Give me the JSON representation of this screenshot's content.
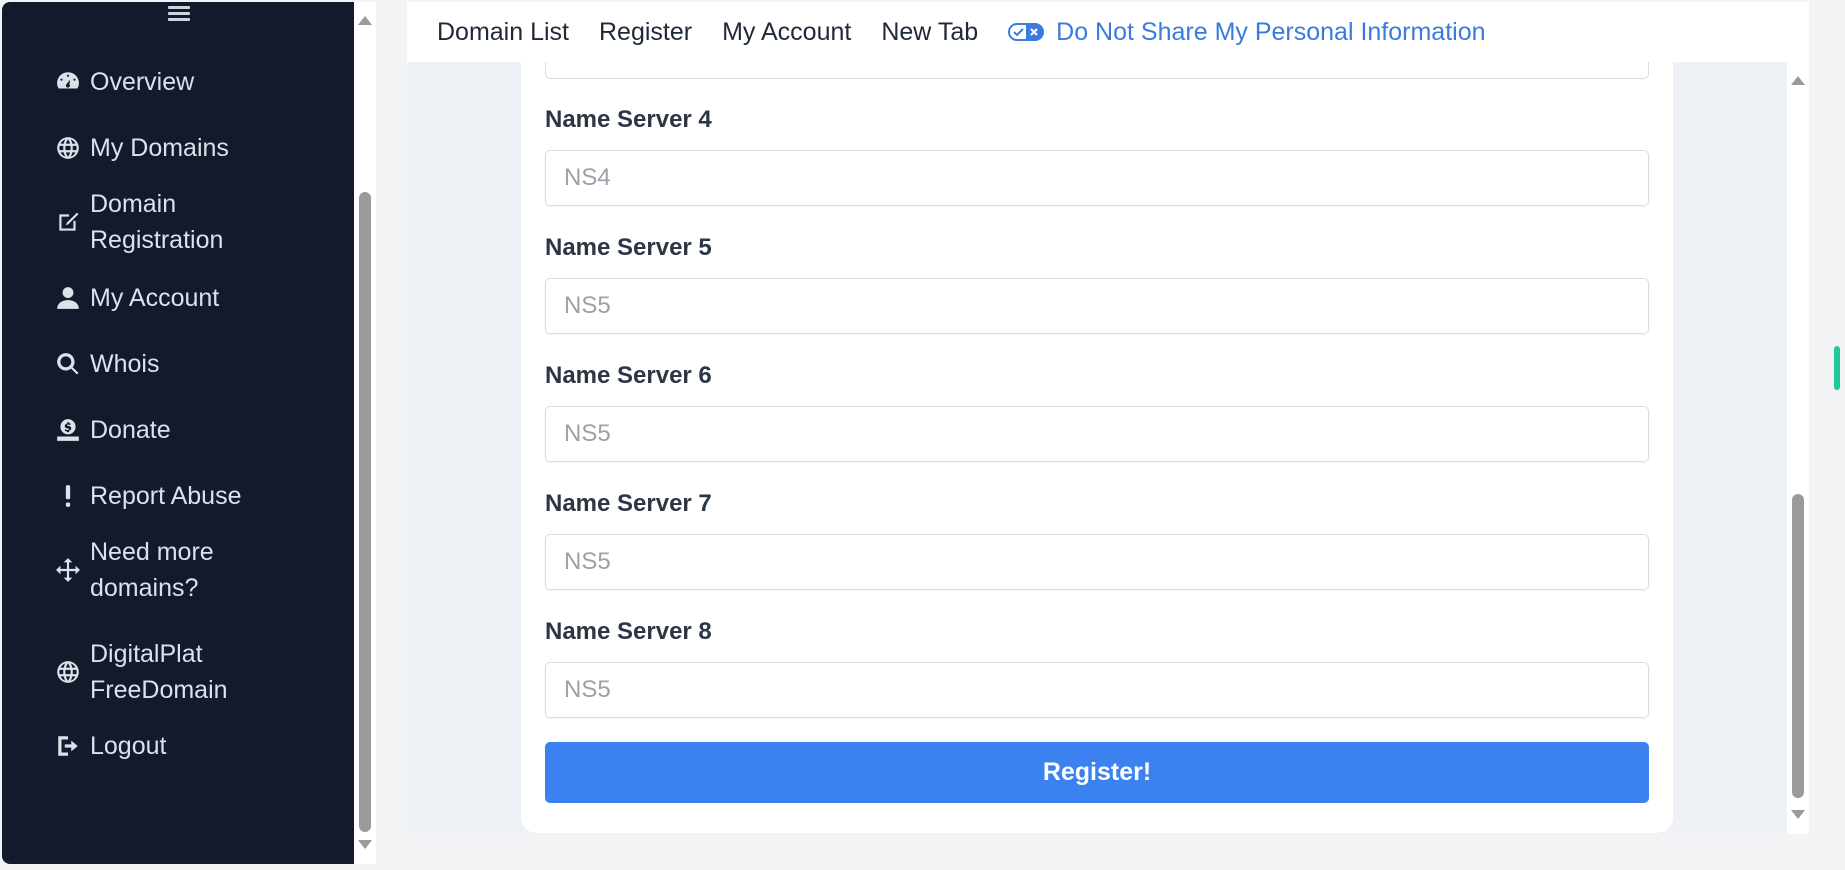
{
  "sidebar": {
    "items": [
      {
        "label": "Overview",
        "icon": "gauge-icon"
      },
      {
        "label": "My Domains",
        "icon": "globe-icon"
      },
      {
        "label": "Domain\nRegistration",
        "icon": "edit-icon"
      },
      {
        "label": "My Account",
        "icon": "user-icon"
      },
      {
        "label": "Whois",
        "icon": "search-icon"
      },
      {
        "label": "Donate",
        "icon": "donate-icon"
      },
      {
        "label": "Report Abuse",
        "icon": "exclamation-icon"
      },
      {
        "label": "Need more\ndomains?",
        "icon": "arrows-move-icon"
      },
      {
        "label": "DigitalPlat\nFreeDomain",
        "icon": "globe-icon"
      },
      {
        "label": "Logout",
        "icon": "logout-icon"
      }
    ]
  },
  "topnav": {
    "domain_list": "Domain List",
    "register": "Register",
    "my_account": "My Account",
    "new_tab": "New Tab",
    "privacy": "Do Not Share My Personal Information"
  },
  "form": {
    "fields": [
      {
        "label": "Name Server 4",
        "placeholder": "NS4"
      },
      {
        "label": "Name Server 5",
        "placeholder": "NS5"
      },
      {
        "label": "Name Server 6",
        "placeholder": "NS5"
      },
      {
        "label": "Name Server 7",
        "placeholder": "NS5"
      },
      {
        "label": "Name Server 8",
        "placeholder": "NS5"
      }
    ],
    "submit_label": "Register!"
  },
  "colors": {
    "sidebar_bg": "#121a2b",
    "primary_button": "#3b82f0",
    "privacy_link": "#3a7be0"
  }
}
